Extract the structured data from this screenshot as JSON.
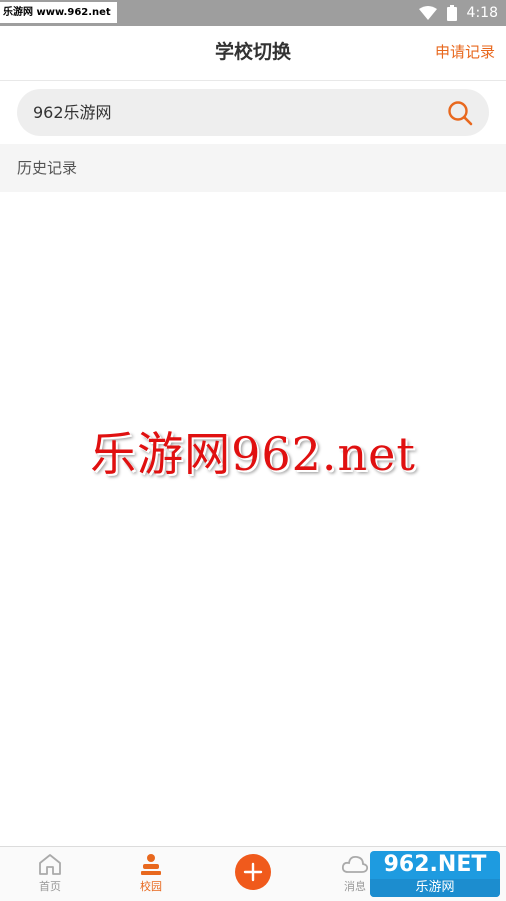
{
  "status_bar": {
    "watermark": "乐游网 www.962.net",
    "time": "4:18"
  },
  "header": {
    "title": "学校切换",
    "action": "申请记录"
  },
  "search": {
    "value": "962乐游网",
    "icon": "search-icon"
  },
  "history": {
    "label": "历史记录"
  },
  "watermark": {
    "text": "乐游网962.net"
  },
  "bottom_nav": {
    "items": [
      {
        "label": "首页",
        "icon": "home-icon",
        "active": false
      },
      {
        "label": "校园",
        "icon": "campus-icon",
        "active": true
      },
      {
        "label": "",
        "icon": "plus-icon",
        "active": false
      },
      {
        "label": "消息",
        "icon": "cloud-icon",
        "active": false
      }
    ]
  },
  "corner_badge": {
    "top": "962.NET",
    "bottom": "乐游网"
  },
  "colors": {
    "accent": "#e8681e",
    "add_button": "#f05a1c",
    "status_bar": "#9e9e9e",
    "search_bg": "#eeeeee",
    "watermark": "#e01010"
  }
}
